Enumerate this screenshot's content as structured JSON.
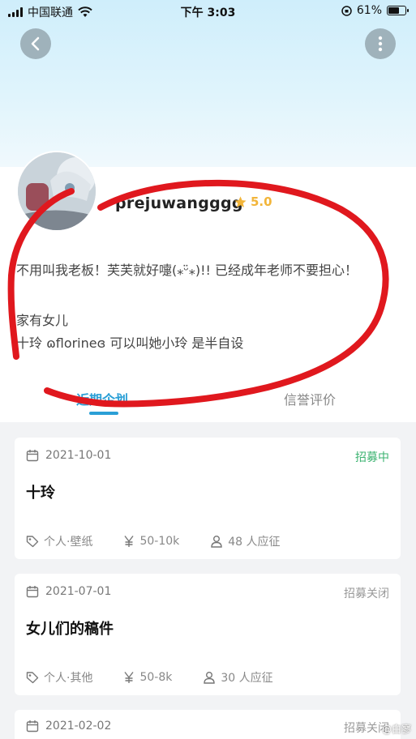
{
  "status_bar": {
    "carrier": "中国联通",
    "time": "下午 3:03",
    "battery_percent": "61%",
    "battery_level": 0.61
  },
  "header": {
    "back_icon": "chevron-left-icon",
    "more_icon": "vertical-dots-icon"
  },
  "profile": {
    "username": "prejuwangggg",
    "rating": "5.0",
    "rating_color": "#f2b53a",
    "bio": [
      "不用叫我老板！芙芙就好嚏(⁎ᵕ̈⁎)!! 已经成年老师不要担心！",
      "",
      "家有女儿",
      "十玲   ɷflorineɞ  可以叫她小玲  是半自设"
    ]
  },
  "tabs": [
    {
      "label": "近期企划",
      "active": true
    },
    {
      "label": "信誉评价",
      "active": false
    }
  ],
  "projects": [
    {
      "date": "2021-10-01",
      "status": "招募中",
      "status_color": "#3cb371",
      "title": "十玲",
      "type": "个人·壁纸",
      "budget": "50-10k",
      "applicants": "48 人应征"
    },
    {
      "date": "2021-07-01",
      "status": "招募关闭",
      "status_color": "#999999",
      "title": "女儿们的稿件",
      "type": "个人·其他",
      "budget": "50-8k",
      "applicants": "30 人应征"
    },
    {
      "date": "2021-02-02",
      "status": "招募关闭",
      "status_color": "#999999"
    }
  ],
  "watermark": "@白寥",
  "annotation_color": "#e0181e",
  "accent_color": "#2a9fd6"
}
